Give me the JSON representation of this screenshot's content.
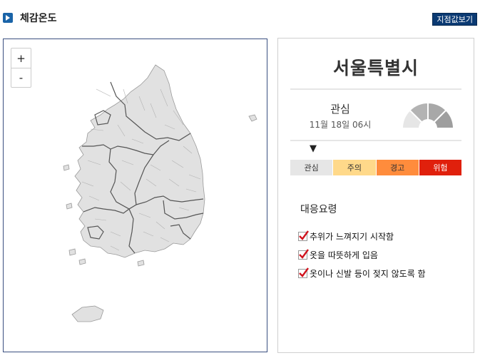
{
  "header": {
    "title": "체감온도",
    "station_button": "지점값보기",
    "icon": "bullet-icon",
    "accent": "#0b3a73"
  },
  "map": {
    "zoom_in": "+",
    "zoom_out": "-",
    "fill": "#e1e1e1",
    "border": "#555555"
  },
  "info": {
    "region": "서울특별시",
    "level": "관심",
    "datetime": "11월 18일 06시",
    "scale": [
      {
        "label": "관심",
        "bg": "#e6e6e6",
        "fg": "#333333"
      },
      {
        "label": "주의",
        "bg": "#ffd98a",
        "fg": "#333333"
      },
      {
        "label": "경고",
        "bg": "#ff8c3c",
        "fg": "#333333"
      },
      {
        "label": "위험",
        "bg": "#e0200c",
        "fg": "#ffffff"
      }
    ],
    "current_level_index": 0,
    "guide_title": "대응요령",
    "guide_items": [
      "추위가 느껴지기 시작함",
      "옷을 따뜻하게 입음",
      "옷이나 신발 등이 젖지 않도록 함"
    ],
    "check_color": "#d0141e"
  }
}
